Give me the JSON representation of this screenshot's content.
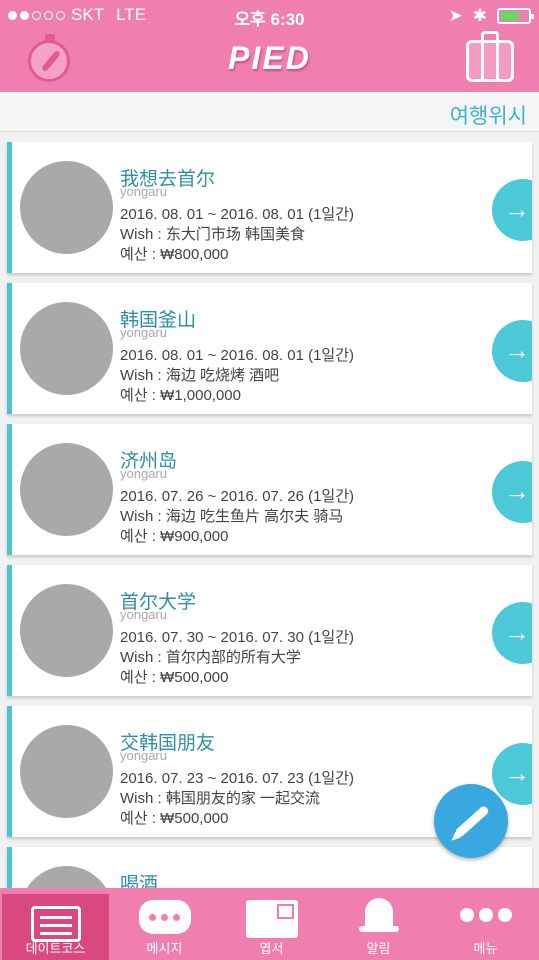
{
  "status": {
    "carrier": "SKT",
    "network": "LTE",
    "time": "오후 6:30"
  },
  "header": {
    "logo": "PIED"
  },
  "subheader": {
    "title": "여행위시"
  },
  "trips": [
    {
      "title": "我想去首尔",
      "user": "yongaru",
      "date": "2016. 08. 01 ~ 2016. 08. 01 (1일간)",
      "wish": "Wish : 东大门市场 韩国美食",
      "budget": "예산 : ₩800,000"
    },
    {
      "title": "韩国釜山",
      "user": "yongaru",
      "date": "2016. 08. 01 ~ 2016. 08. 01 (1일간)",
      "wish": "Wish : 海边 吃烧烤 酒吧",
      "budget": "예산 : ₩1,000,000"
    },
    {
      "title": "济州岛",
      "user": "yongaru",
      "date": "2016. 07. 26 ~ 2016. 07. 26 (1일간)",
      "wish": "Wish : 海边 吃生鱼片 高尔夫 骑马",
      "budget": "예산 : ₩900,000"
    },
    {
      "title": "首尔大学",
      "user": "yongaru",
      "date": "2016. 07. 30 ~ 2016. 07. 30 (1일간)",
      "wish": "Wish : 首尔内部的所有大学",
      "budget": "예산 : ₩500,000"
    },
    {
      "title": "交韩国朋友",
      "user": "yongaru",
      "date": "2016. 07. 23 ~ 2016. 07. 23 (1일간)",
      "wish": "Wish : 韩国朋友的家 一起交流",
      "budget": "예산 : ₩500,000"
    },
    {
      "title": "喝酒"
    }
  ],
  "go_glyph": "→",
  "tabs": [
    {
      "label": "데이트코스"
    },
    {
      "label": "메시지"
    },
    {
      "label": "엽서"
    },
    {
      "label": "알림"
    },
    {
      "label": "메뉴"
    }
  ],
  "icons": {
    "compass": "compass-icon",
    "suitcase": "suitcase-icon",
    "pen": "pen-icon"
  }
}
